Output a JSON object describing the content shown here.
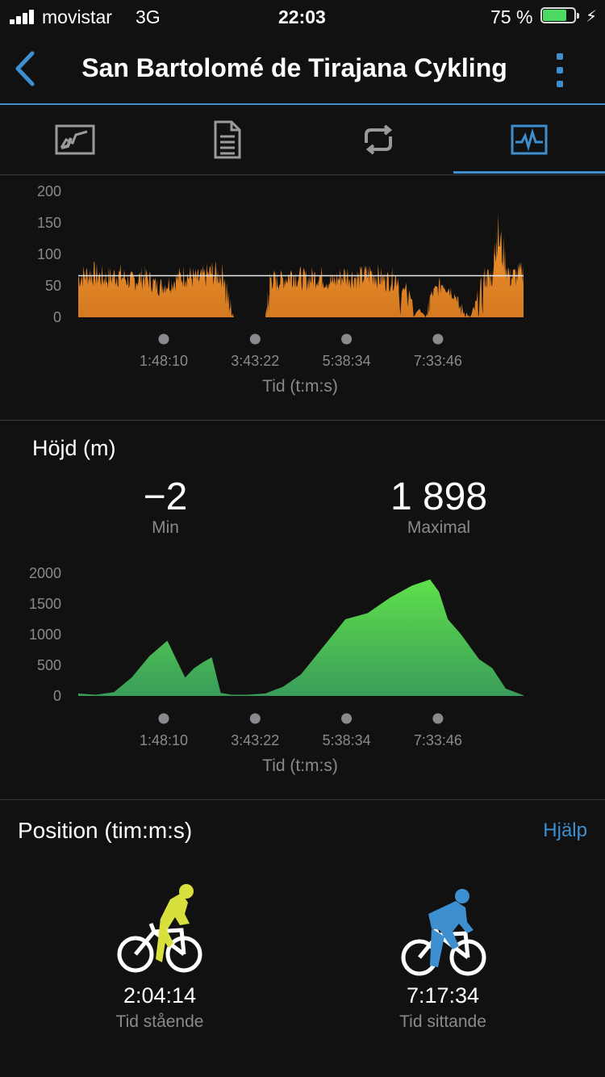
{
  "status_bar": {
    "carrier": "movistar",
    "network": "3G",
    "time": "22:03",
    "battery_percent": "75 %",
    "battery_level": 0.75
  },
  "nav": {
    "title": "San Bartolomé de Tirajana Cykling",
    "back_icon": "chevron-left-icon",
    "more_icon": "more-vertical-icon"
  },
  "tabs": [
    {
      "icon": "map-icon"
    },
    {
      "icon": "details-document-icon"
    },
    {
      "icon": "laps-loop-icon"
    },
    {
      "icon": "charts-icon",
      "selected": true
    }
  ],
  "colors": {
    "accent": "#3d8fd0",
    "cadence_fill": "#e8892a",
    "elevation_fill_top": "#5fe04a",
    "elevation_fill_bottom": "#3a9d5a",
    "standing_rider": "#d7e03c",
    "seated_rider": "#3d8fd0"
  },
  "chart_data": [
    {
      "type": "area",
      "ylim": [
        0,
        200
      ],
      "yticks": [
        "200",
        "150",
        "100",
        "50",
        "0"
      ],
      "xticks": [
        "1:48:10",
        "3:43:22",
        "5:38:34",
        "7:33:46"
      ],
      "xlabel": "Tid (t:m:s)",
      "average_line": 66,
      "x": [
        0,
        0.03,
        0.06,
        0.09,
        0.12,
        0.15,
        0.18,
        0.21,
        0.24,
        0.27,
        0.3,
        0.33,
        0.35,
        0.36,
        0.42,
        0.43,
        0.45,
        0.48,
        0.51,
        0.54,
        0.57,
        0.6,
        0.63,
        0.66,
        0.69,
        0.72,
        0.78,
        0.79,
        0.82,
        0.85,
        0.88,
        0.91,
        0.93,
        0.94,
        0.97,
        1.0
      ],
      "values": [
        78,
        88,
        76,
        84,
        72,
        80,
        60,
        70,
        84,
        74,
        88,
        82,
        0,
        0,
        0,
        78,
        70,
        86,
        74,
        82,
        70,
        84,
        78,
        88,
        72,
        80,
        0,
        40,
        70,
        40,
        0,
        78,
        80,
        170,
        78,
        88
      ]
    },
    {
      "type": "area",
      "title": "Höjd (m)",
      "ylim": [
        0,
        2000
      ],
      "yticks": [
        "2000",
        "1500",
        "1000",
        "500",
        "0"
      ],
      "xticks": [
        "1:48:10",
        "3:43:22",
        "5:38:34",
        "7:33:46"
      ],
      "xlabel": "Tid (t:m:s)",
      "x": [
        0,
        0.04,
        0.08,
        0.12,
        0.16,
        0.2,
        0.24,
        0.26,
        0.28,
        0.3,
        0.32,
        0.345,
        0.35,
        0.38,
        0.42,
        0.46,
        0.5,
        0.55,
        0.6,
        0.65,
        0.7,
        0.75,
        0.79,
        0.81,
        0.83,
        0.86,
        0.9,
        0.93,
        0.96,
        1.0
      ],
      "values": [
        40,
        20,
        60,
        300,
        650,
        900,
        300,
        450,
        550,
        630,
        50,
        20,
        20,
        20,
        40,
        150,
        350,
        800,
        1250,
        1350,
        1600,
        1800,
        1898,
        1700,
        1250,
        1000,
        600,
        450,
        120,
        10
      ]
    }
  ],
  "elevation_stats": {
    "min_value": "−2",
    "min_label": "Min",
    "max_value": "1 898",
    "max_label": "Maximal"
  },
  "position": {
    "heading": "Position (tim:m:s)",
    "help_label": "Hjälp",
    "standing": {
      "value": "2:04:14",
      "label": "Tid stående"
    },
    "seated": {
      "value": "7:17:34",
      "label": "Tid sittande"
    }
  }
}
